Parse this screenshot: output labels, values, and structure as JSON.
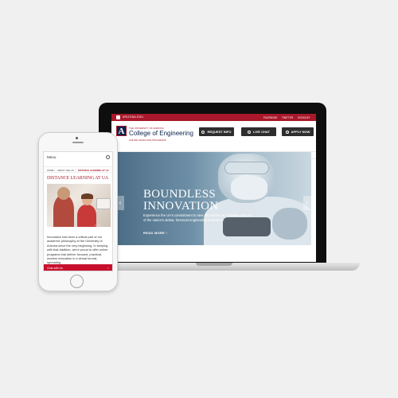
{
  "laptop": {
    "topbar": {
      "brand": "ARIZONA.EDU",
      "social": [
        "FACEBOOK",
        "TWITTER",
        "GOOGLE+"
      ]
    },
    "header": {
      "university": "THE UNIVERSITY OF ARIZONA",
      "college": "College of Engineering",
      "subtitle": "ONLINE GRADUATE PROGRAMS",
      "logo_letter": "A",
      "buttons": [
        "REQUEST INFO",
        "LIVE CHAT",
        "APPLY NOW"
      ]
    },
    "nav": [
      "Online Programs",
      "Faculty",
      "Tuition",
      "Admissions",
      "About the UA",
      "Contact",
      "International Students"
    ],
    "hero": {
      "title_line1": "BOUNDLESS",
      "title_line2": "INNOVATION",
      "description": "Experience the UA's commitment to new discoveries at a leading and one of the nation's oldest, foremost engineering institutions.",
      "read_more": "READ MORE ›",
      "prev_arrow": "‹",
      "next_arrow": "›"
    }
  },
  "phone": {
    "menu_label": "Menu",
    "breadcrumb": [
      "HOME",
      "/",
      "ABOUT THE UA",
      "/",
      "DISTANCE LEARNING AT UA"
    ],
    "page_title": "DISTANCE LEARNING AT UA",
    "carousel_dots": "• • •",
    "body_text": "Innovation has been a critical part of our academic philosophy at the University of Arizona since the very beginning. In keeping with that tradition, we're proud to offer online programs that deliver focused, practical, modern education in a virtual format, spreading",
    "cta_label": "Chat with Us",
    "cta_arrow": "›"
  },
  "colors": {
    "brand_red": "#a8182a",
    "brand_navy": "#0c234b",
    "cta_red": "#c8102e",
    "dark_button": "#2e2e2e"
  },
  "icons": [
    "search-icon",
    "phone-icon",
    "chat-icon",
    "pencil-icon"
  ]
}
